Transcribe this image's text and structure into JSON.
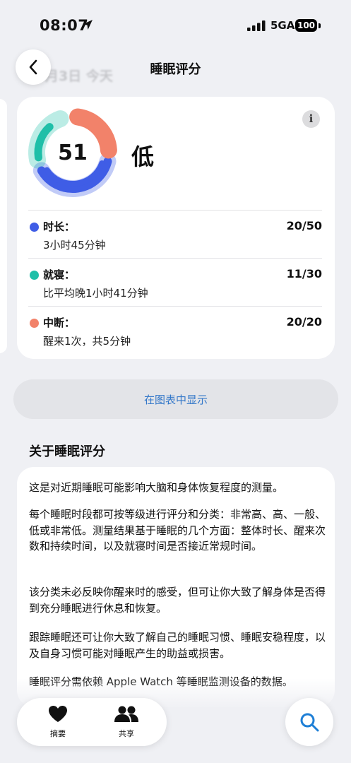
{
  "status_bar": {
    "time": "08:07",
    "network": "5GA",
    "battery": "100"
  },
  "nav": {
    "title": "睡眠评分",
    "date_ghost": "月3日 今天"
  },
  "score": {
    "value": 51,
    "level": "低",
    "colors": {
      "duration": "#3f5de6",
      "bedtime": "#1fbfa8",
      "interruption": "#f2826a"
    },
    "metrics": [
      {
        "name": "时长：",
        "score": "20/50",
        "detail": "3小时45分钟",
        "color": "#3f5de6"
      },
      {
        "name": "就寝：",
        "score": "11/30",
        "detail": "比平均晚1小时41分钟",
        "color": "#1fbfa8"
      },
      {
        "name": "中断：",
        "score": "20/20",
        "detail": "醒来1次，共5分钟",
        "color": "#f2826a"
      }
    ]
  },
  "chart_button": "在图表中显示",
  "about": {
    "title": "关于睡眠评分",
    "paragraphs": [
      "这是对近期睡眠可能影响大脑和身体恢复程度的测量。",
      "每个睡眠时段都可按等级进行评分和分类：非常高、高、一般、低或非常低。测量结果基于睡眠的几个方面：整体时长、醒来次数和持续时间，以及就寝时间是否接近常规时间。",
      "该分类未必反映你醒来时的感受，但可让你大致了解身体是否得到充分睡眠进行休息和恢复。",
      "跟踪睡眠还可让你大致了解自己的睡眠习惯、睡眠安稳程度，以及自身习惯可能对睡眠产生的助益或损害。",
      "睡眠评分需依赖 Apple Watch 等睡眠监测设备的数据。"
    ]
  },
  "tabbar": {
    "summary": "摘要",
    "sharing": "共享"
  }
}
